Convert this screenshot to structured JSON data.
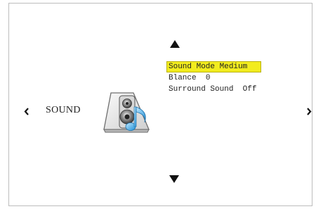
{
  "page": {
    "title": "SOUND"
  },
  "nav": {
    "up_icon": "triangle-up-icon",
    "down_icon": "triangle-down-icon",
    "left_icon": "chevron-left-icon",
    "right_icon": "chevron-right-icon"
  },
  "menu": {
    "items": [
      {
        "label": "Sound Mode",
        "value": "Medium",
        "selected": true
      },
      {
        "label": "Blance",
        "value": "0",
        "selected": false
      },
      {
        "label": "Surround Sound",
        "value": "Off",
        "selected": false
      }
    ],
    "highlight_color": "#f2ec1e"
  },
  "icon": {
    "name": "speaker-music-icon"
  }
}
